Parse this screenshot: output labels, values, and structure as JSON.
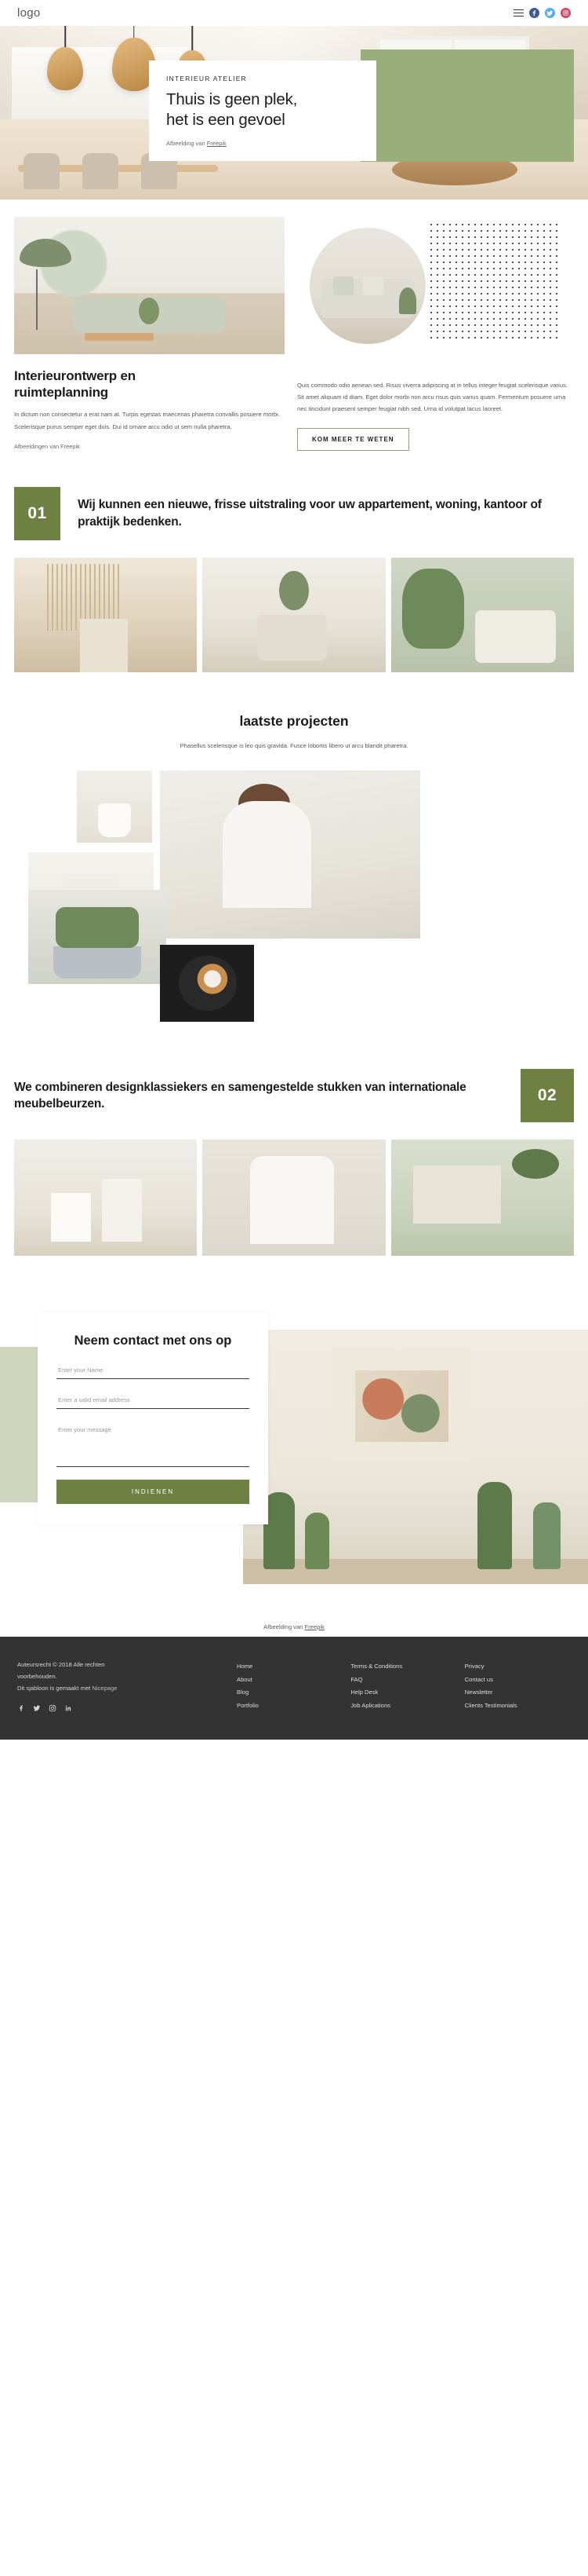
{
  "header": {
    "logo": "logo",
    "menu_icon": "hamburger-menu",
    "social": [
      {
        "name": "facebook",
        "color": "#3b5998"
      },
      {
        "name": "twitter",
        "color": "#55acee"
      },
      {
        "name": "instagram",
        "color": "#e4405f"
      }
    ]
  },
  "hero": {
    "kicker": "INTERIEUR ATELIER",
    "title_line1": "Thuis is geen plek,",
    "title_line2": "het is een gevoel",
    "credit_prefix": "Afbeelding van ",
    "credit_link": "Freepik",
    "accent_color": "#9aae7b"
  },
  "intro": {
    "heading_line1": "Interieurontwerp en",
    "heading_line2": "ruimteplanning",
    "left_text": "In dictum non consectetur a erat nam at. Turpis egestas maecenas pharetra convallis posuere morbi. Scelerisque purus semper eget duis. Dui id ornare arcu odio ut sem nulla pharetra.",
    "caption": "Afbeeldingen van Freepik",
    "right_text": "Quis commodo odio aenean sed. Risus viverra adipiscing at in tellus integer feugiat scelerisque varius. Sit amet aliquam id diam. Eget dolor morbi non arcu risus quis varius quam. Fermentum posuere urna nec tincidunt praesent semper feugiat nibh sed. Urna id volutpat lacus laoreet.",
    "button": "KOM MEER TE WETEN"
  },
  "band_one": {
    "number": "01",
    "text": "Wij kunnen een nieuwe, frisse uitstraling voor uw appartement, woning, kantoor of praktijk bedenken.",
    "color": "#6f8043"
  },
  "projects": {
    "heading": "laatste projecten",
    "subtext": "Phasellus scelerisque is leo quis gravida. Fusce lobortis libero ut arcu blandit pharetra."
  },
  "band_two": {
    "number": "02",
    "text": "We combineren designklassiekers en samengestelde stukken van internationale meubelbeurzen.",
    "color": "#6f8043"
  },
  "contact": {
    "heading": "Neem contact met ons op",
    "name_placeholder": "Enter your Name",
    "email_placeholder": "Enter a valid email address",
    "message_placeholder": "Enter your message",
    "submit": "INDIENEN",
    "credit_prefix": "Afbeelding van ",
    "credit_link": "Freepik",
    "band_color": "#cfd6bd",
    "button_color": "#6f8043"
  },
  "footer": {
    "copyright_line1": "Auteursrecht © 2018 Alle rechten",
    "copyright_line2": "voorbehouden.",
    "template_prefix": "Dit sjabloon is gemaakt met ",
    "template_brand": "Nicepage",
    "columns": [
      {
        "links": [
          "Home",
          "About",
          "Blog",
          "Portfolio"
        ]
      },
      {
        "links": [
          "Terms & Conditions",
          "FAQ",
          "Help Desk",
          "Job Aplications"
        ]
      },
      {
        "links": [
          "Privacy",
          "Contact us",
          "Newsletter",
          "Clients Testimonials"
        ]
      }
    ],
    "social": [
      "facebook",
      "twitter",
      "instagram",
      "linkedin"
    ],
    "background": "#333333"
  }
}
